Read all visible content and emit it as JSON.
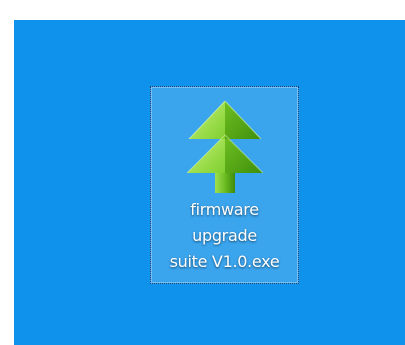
{
  "desktop": {
    "background_color": "#0f92eb",
    "icon": {
      "label": "firmware\nupgrade\nsuite V1.0.exe",
      "icon_name": "green-double-arrow-up-icon",
      "selected": true,
      "colors": {
        "arrow_light": "#9be04c",
        "arrow_dark": "#4a9e12",
        "selection": "#78bef0"
      }
    }
  }
}
